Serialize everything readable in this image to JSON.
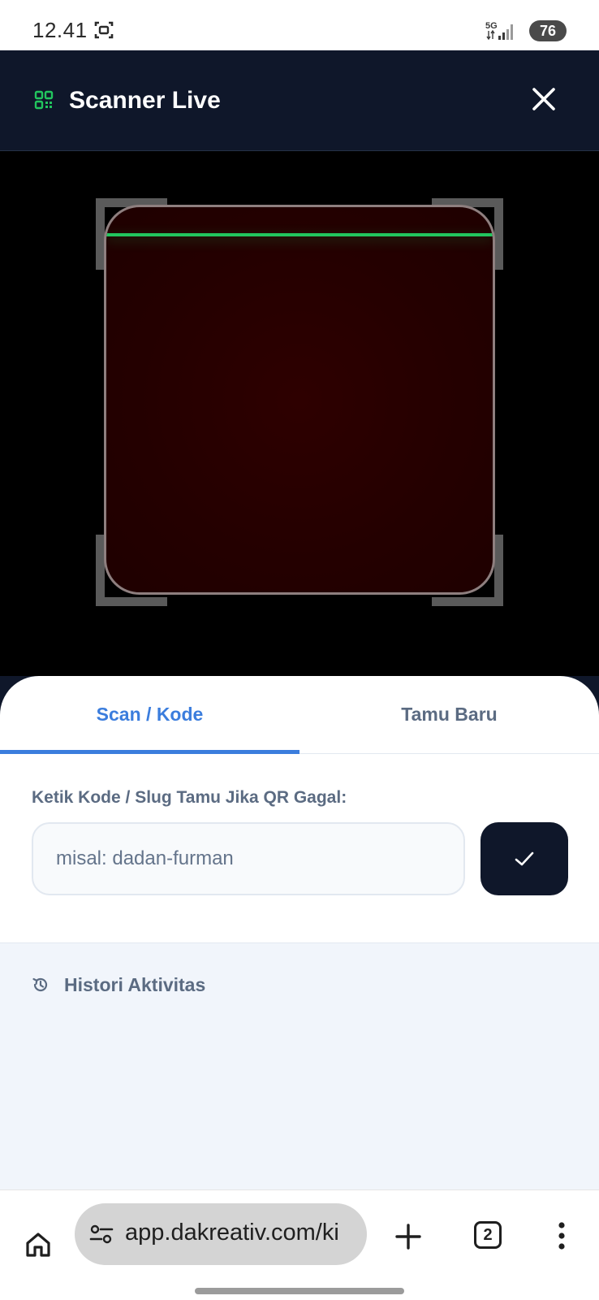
{
  "status_bar": {
    "time": "12.41",
    "network": "5G",
    "battery": "76"
  },
  "header": {
    "title": "Scanner Live",
    "qr_icon": "qr-code-icon",
    "close_icon": "close-icon",
    "accent_color": "#22c55e",
    "background_color": "#0f172a"
  },
  "scanner": {
    "scan_line_color": "#22c55e"
  },
  "tabs": [
    {
      "label": "Scan / Kode",
      "active": true
    },
    {
      "label": "Tamu Baru",
      "active": false
    }
  ],
  "manual_entry": {
    "label": "Ketik Kode / Slug Tamu Jika QR Gagal:",
    "placeholder": "misal: dadan-furman",
    "value": "",
    "submit_icon": "check-icon"
  },
  "history": {
    "icon": "history-icon",
    "title": "Histori Aktivitas"
  },
  "browser": {
    "url": "app.dakreativ.com/ki",
    "tab_count": "2",
    "home_icon": "home-icon",
    "site_settings_icon": "site-settings-icon",
    "new_tab_icon": "plus-icon",
    "menu_icon": "more-vert-icon"
  }
}
